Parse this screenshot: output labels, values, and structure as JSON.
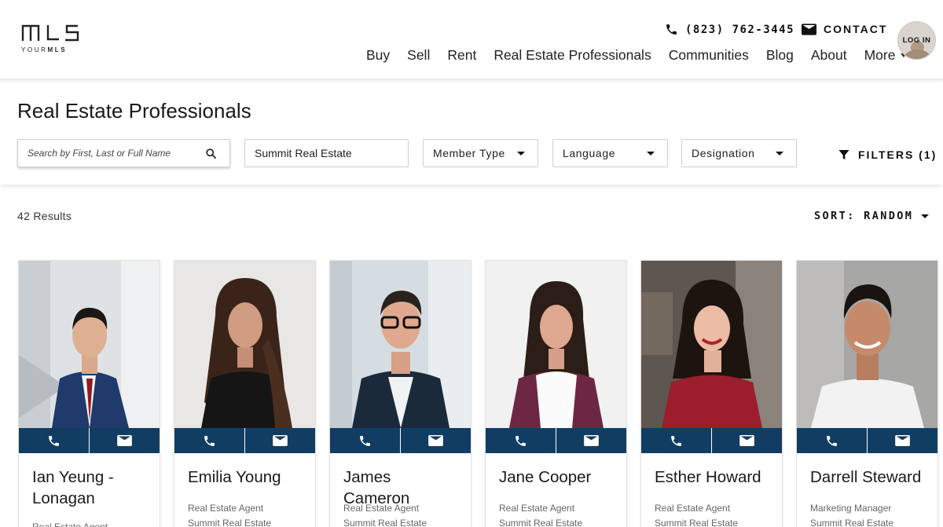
{
  "header": {
    "logo_text": "MLS",
    "logo_sub_1": "YOUR",
    "logo_sub_2": "MLS",
    "phone": "(823) 762-3445",
    "contact_label": "CONTACT",
    "login_label": "LOG IN",
    "nav": [
      {
        "label": "Buy"
      },
      {
        "label": "Sell"
      },
      {
        "label": "Rent"
      },
      {
        "label": "Real Estate Professionals"
      },
      {
        "label": "Communities"
      },
      {
        "label": "Blog"
      },
      {
        "label": "About"
      },
      {
        "label": "More"
      }
    ]
  },
  "search": {
    "title": "Real Estate Professionals",
    "name_placeholder": "Search by First, Last or Full Name",
    "office_value": "Summit Real Estate",
    "member_type": "Member Type",
    "language": "Language",
    "designation": "Designation",
    "filters_label": "FILTERS (1)"
  },
  "results": {
    "count_label": "42 Results",
    "sort_label": "SORT: RANDOM"
  },
  "colors": {
    "accent": "#123d63"
  },
  "icons": [
    "phone-icon",
    "mail-icon",
    "search-icon",
    "filter-icon",
    "chevron-down-icon"
  ],
  "agents": [
    {
      "name": "Ian Yeung - Lonagan",
      "role": "Real Estate Agent",
      "office": ""
    },
    {
      "name": "Emilia Young",
      "role": "Real Estate Agent",
      "office": "Summit Real Estate"
    },
    {
      "name": "James Cameron",
      "role": "Real Estate Agent",
      "office": "Summit Real Estate"
    },
    {
      "name": "Jane Cooper",
      "role": "Real Estate Agent",
      "office": "Summit Real Estate"
    },
    {
      "name": "Esther Howard",
      "role": "Real Estate Agent",
      "office": "Summit Real Estate"
    },
    {
      "name": "Darrell Steward",
      "role": "Marketing Manager",
      "office": "Summit Real Estate"
    }
  ]
}
